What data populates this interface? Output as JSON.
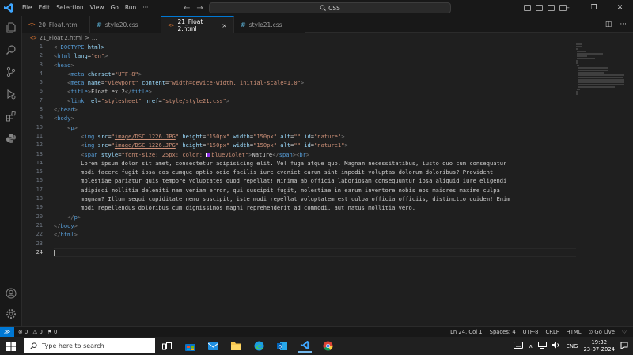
{
  "titlebar": {
    "menu": [
      "File",
      "Edit",
      "Selection",
      "View",
      "Go",
      "Run",
      "···"
    ],
    "search_text": "CSS",
    "back_glyph": "←",
    "forward_glyph": "→",
    "minimize_glyph": "–",
    "restore_glyph": "❐",
    "close_glyph": "✕"
  },
  "tabs": [
    {
      "label": "20_Float.html",
      "icon": "html-file-icon",
      "active": false
    },
    {
      "label": "style20.css",
      "icon": "css-file-icon",
      "active": false
    },
    {
      "label": "21_Float 2.html",
      "icon": "html-file-icon",
      "active": true
    },
    {
      "label": "style21.css",
      "icon": "css-file-icon",
      "active": false
    }
  ],
  "tab_close_glyph": "×",
  "icon_glyphs": {
    "html": "<>",
    "css": "#"
  },
  "tab_actions": {
    "split_glyph": "◫",
    "more_glyph": "···"
  },
  "breadcrumb": {
    "file": "21_Float 2.html",
    "separator": ">",
    "rest": "..."
  },
  "editor": {
    "line_numbers": [
      "1",
      "2",
      "3",
      "4",
      "5",
      "6",
      "7",
      "8",
      "9",
      "10",
      "11",
      "12",
      "13",
      "14",
      "15",
      "16",
      "17",
      "18",
      "19",
      "20",
      "21",
      "22",
      "23",
      "24"
    ],
    "current_line": 24,
    "lines": [
      "<!DOCTYPE html>",
      "<html lang=\"en\">",
      "<head>",
      "    <meta charset=\"UTF-8\">",
      "    <meta name=\"viewport\" content=\"width=device-width, initial-scale=1.0\">",
      "    <title>Float ex 2</title>",
      "    <link rel=\"stylesheet\" href=\"style/style21.css\">",
      "</head>",
      "<body>",
      "    <p>",
      "        <img src=\"image/DSC_1226.JPG\" height=\"150px\" width=\"150px\" alt=\"\" id=\"nature\">",
      "        <img src=\"image/DSC_1226.JPG\" height=\"150px\" width=\"150px\" alt=\"\" id=\"nature1\">",
      "        <span style=\"font-size: 25px; color: blueviolet\">Nature</span><br>",
      "        Lorem ipsum dolor sit amet, consectetur adipisicing elit. Vel fuga atque quo. Magnam necessitatibus, iusto quo cum consequatur",
      "        modi facere fugit ipsa eos cumque optio odio facilis iure eveniet earum sint impedit voluptas dolorum doloribus? Provident",
      "        molestiae pariatur quis tempore voluptates quod repellat! Minima ab officia laboriosam consequuntur ipsa aliquid iure eligendi",
      "        adipisci mollitia deleniti nam veniam error, qui suscipit fugit, molestiae in earum inventore nobis eos maiores maxime culpa",
      "        magnam? Illum sequi cupiditate nemo suscipit, iste modi repellat voluptatem est culpa officia officiis, distinctio quidem! Enim",
      "        modi repellendus doloribus cum dignissimos magni reprehenderit ad commodi, aut natus mollitia vero.",
      "    </p>",
      "</body>",
      "</html>",
      "",
      ""
    ]
  },
  "statusbar": {
    "remote_glyph": "≫",
    "errors": "⊗ 0",
    "warnings": "⚠ 0",
    "ports": "⚑ 0",
    "position": "Ln 24, Col 1",
    "spaces": "Spaces: 4",
    "encoding": "UTF-8",
    "eol": "CRLF",
    "language": "HTML",
    "golive": "⊙ Go Live",
    "notifications_glyph": "♡"
  },
  "taskbar": {
    "search_placeholder": "Type here to search",
    "language": "ENG",
    "time": "19:32",
    "date": "23-07-2024",
    "tray_arrow": "∧"
  },
  "colors": {
    "accent": "#0078d4",
    "html_icon": "#e37933",
    "css_icon": "#519aba",
    "swatch_blueviolet": "#8a2be2"
  }
}
